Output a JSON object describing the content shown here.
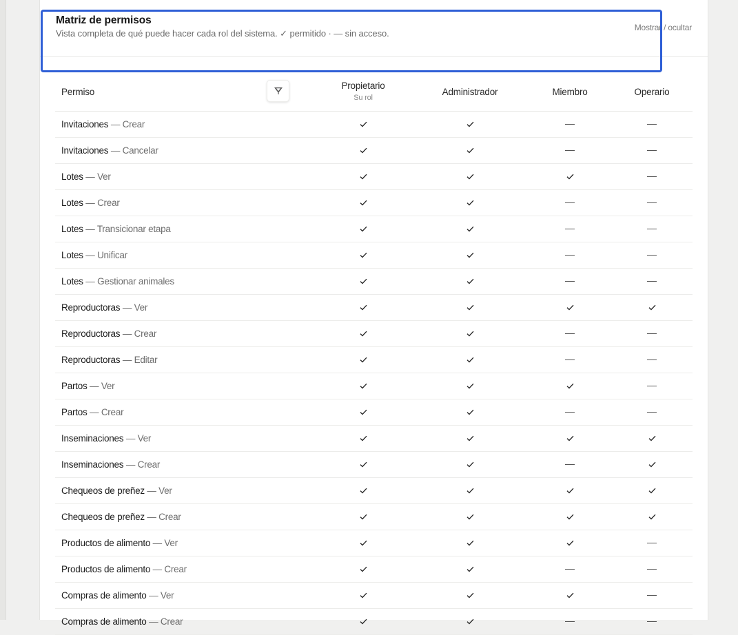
{
  "header": {
    "title": "Matriz de permisos",
    "subtitle": "Vista completa de qué puede hacer cada rol del sistema. ✓ permitido · — sin acceso.",
    "toggle_label": "Mostrar / ocultar"
  },
  "table": {
    "permission_header": "Permiso",
    "separator": "—",
    "roles": [
      {
        "name": "Propietario",
        "sub": "Su rol"
      },
      {
        "name": "Administrador",
        "sub": ""
      },
      {
        "name": "Miembro",
        "sub": ""
      },
      {
        "name": "Operario",
        "sub": ""
      }
    ],
    "rows": [
      {
        "resource": "Invitaciones",
        "action": "Crear",
        "access": [
          true,
          true,
          false,
          false
        ]
      },
      {
        "resource": "Invitaciones",
        "action": "Cancelar",
        "access": [
          true,
          true,
          false,
          false
        ]
      },
      {
        "resource": "Lotes",
        "action": "Ver",
        "access": [
          true,
          true,
          true,
          false
        ]
      },
      {
        "resource": "Lotes",
        "action": "Crear",
        "access": [
          true,
          true,
          false,
          false
        ]
      },
      {
        "resource": "Lotes",
        "action": "Transicionar etapa",
        "access": [
          true,
          true,
          false,
          false
        ]
      },
      {
        "resource": "Lotes",
        "action": "Unificar",
        "access": [
          true,
          true,
          false,
          false
        ]
      },
      {
        "resource": "Lotes",
        "action": "Gestionar animales",
        "access": [
          true,
          true,
          false,
          false
        ]
      },
      {
        "resource": "Reproductoras",
        "action": "Ver",
        "access": [
          true,
          true,
          true,
          true
        ]
      },
      {
        "resource": "Reproductoras",
        "action": "Crear",
        "access": [
          true,
          true,
          false,
          false
        ]
      },
      {
        "resource": "Reproductoras",
        "action": "Editar",
        "access": [
          true,
          true,
          false,
          false
        ]
      },
      {
        "resource": "Partos",
        "action": "Ver",
        "access": [
          true,
          true,
          true,
          false
        ]
      },
      {
        "resource": "Partos",
        "action": "Crear",
        "access": [
          true,
          true,
          false,
          false
        ]
      },
      {
        "resource": "Inseminaciones",
        "action": "Ver",
        "access": [
          true,
          true,
          true,
          true
        ]
      },
      {
        "resource": "Inseminaciones",
        "action": "Crear",
        "access": [
          true,
          true,
          false,
          true
        ]
      },
      {
        "resource": "Chequeos de preñez",
        "action": "Ver",
        "access": [
          true,
          true,
          true,
          true
        ]
      },
      {
        "resource": "Chequeos de preñez",
        "action": "Crear",
        "access": [
          true,
          true,
          true,
          true
        ]
      },
      {
        "resource": "Productos de alimento",
        "action": "Ver",
        "access": [
          true,
          true,
          true,
          false
        ]
      },
      {
        "resource": "Productos de alimento",
        "action": "Crear",
        "access": [
          true,
          true,
          false,
          false
        ]
      },
      {
        "resource": "Compras de alimento",
        "action": "Ver",
        "access": [
          true,
          true,
          true,
          false
        ]
      },
      {
        "resource": "Compras de alimento",
        "action": "Crear",
        "access": [
          true,
          true,
          false,
          false
        ]
      }
    ]
  },
  "icons": {
    "filter": "filter-icon",
    "check": "check-icon",
    "dash": "dash-icon"
  },
  "colors": {
    "focus_outline": "#2f5fd6",
    "background": "#f0f0ef",
    "card": "#ffffff"
  }
}
